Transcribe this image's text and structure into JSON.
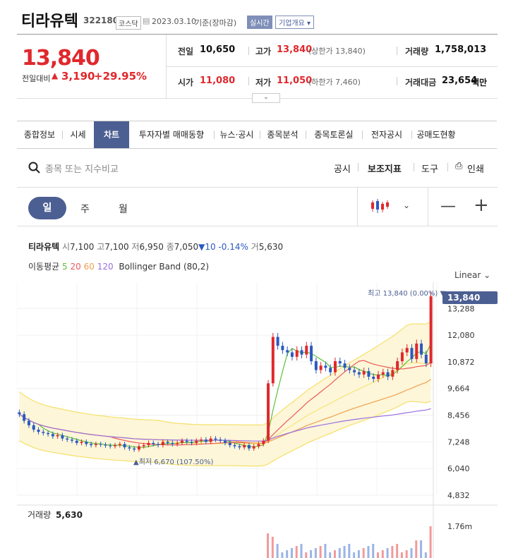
{
  "header": {
    "name": "티라유텍",
    "code": "322180",
    "market": "코스닥",
    "date": "2023.03.10",
    "basis": "기준(장마감)",
    "realtime": "실시간",
    "company_overview": "기업개요"
  },
  "quote": {
    "price": "13,840",
    "prev_label": "전일대비",
    "change": "3,190",
    "change_pct": "+29.95%",
    "rows": [
      [
        {
          "label": "전일",
          "value": "10,650",
          "red": false,
          "sub": ""
        },
        {
          "label": "고가",
          "value": "13,840",
          "red": true,
          "sub": "(상한가 13,840)"
        },
        {
          "label": "거래량",
          "value": "1,758,013",
          "red": false,
          "sub": ""
        }
      ],
      [
        {
          "label": "시가",
          "value": "11,080",
          "red": true,
          "sub": ""
        },
        {
          "label": "저가",
          "value": "11,050",
          "red": true,
          "sub": "(하한가 7,460)"
        },
        {
          "label": "거래대금",
          "value": "23,654",
          "red": false,
          "sub": "백만"
        }
      ]
    ]
  },
  "tabs": [
    "종합정보",
    "시세",
    "차트",
    "투자자별 매매동향",
    "뉴스·공시",
    "종목분석",
    "종목토론실",
    "전자공시",
    "공매도현황"
  ],
  "active_tab": "차트",
  "search": {
    "placeholder": "종목 또는 지수비교"
  },
  "tools": {
    "disclosure": "공시",
    "indicators": "보조지표",
    "tools": "도구",
    "print": "인쇄"
  },
  "periods": {
    "day": "일",
    "week": "주",
    "month": "월"
  },
  "info_line": {
    "name": "티라유텍",
    "open_lbl": "시",
    "open": "7,100",
    "high_lbl": "고",
    "high": "7,100",
    "low_lbl": "저",
    "low": "6,950",
    "close_lbl": "종",
    "close": "7,050",
    "change": "▼10 -0.14%",
    "vol_lbl": "거",
    "vol": "5,630"
  },
  "ma_line": {
    "label": "이동평균",
    "ma5": "5",
    "ma20": "20",
    "ma60": "60",
    "ma120": "120",
    "bollinger": "Bollinger Band (80,2)"
  },
  "scale": "Linear",
  "colors": {
    "up": "#e0282d",
    "down": "#2b59c3",
    "ma5": "#5fbf3a",
    "ma20": "#ec5a5a",
    "ma60": "#f0a050",
    "ma120": "#9b6fe0",
    "band": "#f5e06a",
    "accent": "#4c5f93"
  },
  "chart_data": {
    "type": "candlestick",
    "y_ticks": [
      "13,288",
      "12,080",
      "10,872",
      "9,664",
      "8,456",
      "7,248",
      "6,040",
      "4,832"
    ],
    "ylim": [
      4832,
      13840
    ],
    "current_price": "13,840",
    "high_annotation": "최고 13,840 (0.00%)",
    "low_annotation": "▲최저 6,670 (107.50%)",
    "candles": [
      8500,
      8200,
      8000,
      7800,
      7700,
      7650,
      7600,
      7500,
      7550,
      7400,
      7350,
      7300,
      7200,
      7250,
      7150,
      7100,
      7150,
      7120,
      7080,
      7050,
      7100,
      7150,
      7000,
      6950,
      6900,
      7050,
      7100,
      7200,
      7150,
      7100,
      7250,
      7200,
      7150,
      7200,
      7300,
      7250,
      7200,
      7300,
      7350,
      7250,
      7400,
      7350,
      7300,
      7200,
      7100,
      7050,
      7000,
      7100,
      6950,
      7050,
      7150,
      7300,
      9900,
      12000,
      11600,
      11400,
      11300,
      11100,
      11400,
      11200,
      11600,
      10900,
      10500,
      10700,
      10600,
      10400,
      10900,
      10800,
      10600,
      10500,
      10400,
      10300,
      10450,
      10200,
      10100,
      10300,
      10400,
      10200,
      10500,
      10900,
      11300,
      11500,
      11000,
      11700,
      11200,
      10800,
      13840
    ],
    "volume_label": "거래량",
    "volume": "5,630",
    "volume_tick": "1.76m"
  }
}
